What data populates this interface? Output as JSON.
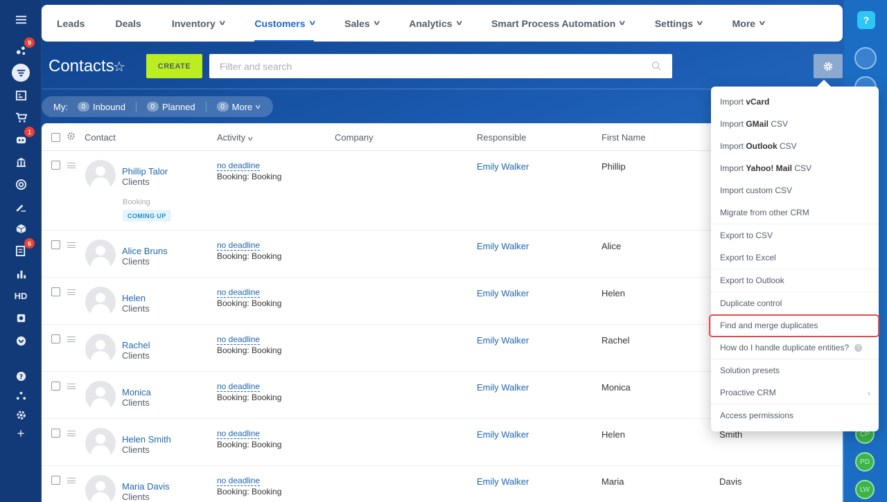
{
  "left_sidebar": {
    "badges": {
      "flow": "9",
      "robot": "1",
      "tasks": "6"
    },
    "hd_label": "HD"
  },
  "right_sidebar": {
    "help": "?",
    "avatars": [
      "CP",
      "PD",
      "LW"
    ]
  },
  "topnav": {
    "items": [
      {
        "label": "Leads",
        "dropdown": false
      },
      {
        "label": "Deals",
        "dropdown": false
      },
      {
        "label": "Inventory",
        "dropdown": true
      },
      {
        "label": "Customers",
        "dropdown": true,
        "active": true
      },
      {
        "label": "Sales",
        "dropdown": true
      },
      {
        "label": "Analytics",
        "dropdown": true
      },
      {
        "label": "Smart Process Automation",
        "dropdown": true
      },
      {
        "label": "Settings",
        "dropdown": true
      },
      {
        "label": "More",
        "dropdown": true
      }
    ]
  },
  "page": {
    "title": "Contacts",
    "create_label": "CREATE",
    "search_placeholder": "Filter and search"
  },
  "counters": {
    "my_label": "My:",
    "items": [
      {
        "count": "0",
        "label": "Inbound"
      },
      {
        "count": "0",
        "label": "Planned"
      },
      {
        "count": "0",
        "label": "More"
      }
    ]
  },
  "grid": {
    "columns": [
      "Contact",
      "Activity",
      "Company",
      "Responsible",
      "First Name"
    ],
    "rows": [
      {
        "name": "Phillip Talor",
        "type": "Clients",
        "deadline": "no deadline",
        "activity": "Booking: Booking",
        "responsible": "Emily Walker",
        "first_name": "Phillip",
        "last_name": "",
        "booking_label": "Booking",
        "booking_badge": "COMING UP"
      },
      {
        "name": "Alice Bruns",
        "type": "Clients",
        "deadline": "no deadline",
        "activity": "Booking: Booking",
        "responsible": "Emily Walker",
        "first_name": "Alice",
        "last_name": ""
      },
      {
        "name": "Helen",
        "type": "Clients",
        "deadline": "no deadline",
        "activity": "Booking: Booking",
        "responsible": "Emily Walker",
        "first_name": "Helen",
        "last_name": ""
      },
      {
        "name": "Rachel",
        "type": "Clients",
        "deadline": "no deadline",
        "activity": "Booking: Booking",
        "responsible": "Emily Walker",
        "first_name": "Rachel",
        "last_name": ""
      },
      {
        "name": "Monica",
        "type": "Clients",
        "deadline": "no deadline",
        "activity": "Booking: Booking",
        "responsible": "Emily Walker",
        "first_name": "Monica",
        "last_name": ""
      },
      {
        "name": "Helen Smith",
        "type": "Clients",
        "deadline": "no deadline",
        "activity": "Booking: Booking",
        "responsible": "Emily Walker",
        "first_name": "Helen",
        "last_name": "Smith"
      },
      {
        "name": "Maria Davis",
        "type": "Clients",
        "deadline": "no deadline",
        "activity": "Booking: Booking",
        "responsible": "Emily Walker",
        "first_name": "Maria",
        "last_name": "Davis"
      }
    ]
  },
  "menu": {
    "import_vcard": {
      "prefix": "Import ",
      "bold": "vCard",
      "suffix": ""
    },
    "import_gmail": {
      "prefix": "Import ",
      "bold": "GMail",
      "suffix": " CSV"
    },
    "import_outlook": {
      "prefix": "Import ",
      "bold": "Outlook",
      "suffix": " CSV"
    },
    "import_yahoo": {
      "prefix": "Import ",
      "bold": "Yahoo! Mail",
      "suffix": " CSV"
    },
    "import_custom": "Import custom CSV",
    "migrate": "Migrate from other CRM",
    "export_csv": "Export to CSV",
    "export_excel": "Export to Excel",
    "export_outlook": "Export to Outlook",
    "duplicate_control": "Duplicate control",
    "find_merge": "Find and merge duplicates",
    "handle_duplicates": "How do I handle duplicate entities?",
    "solution_presets": "Solution presets",
    "proactive_crm": "Proactive CRM",
    "access_permissions": "Access permissions"
  },
  "colors": {
    "accent": "#1f66c4",
    "create_button": "#bbed21",
    "highlight_border": "#e24b4b",
    "link": "#2067b0"
  }
}
